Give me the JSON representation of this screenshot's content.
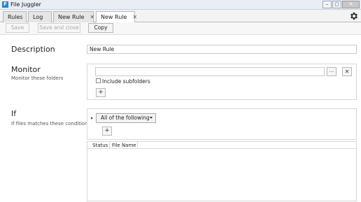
{
  "window": {
    "title": "File Juggler",
    "app_icon_letter": "F",
    "min_glyph": "–",
    "max_glyph": "▢",
    "close_glyph": "✕"
  },
  "tabs": [
    {
      "label": "Rules",
      "active": false,
      "closable": false
    },
    {
      "label": "Log",
      "active": false,
      "closable": false
    },
    {
      "label": "New Rule",
      "active": false,
      "closable": true
    },
    {
      "label": "New Rule",
      "active": true,
      "closable": true
    }
  ],
  "tab_close_glyph": "✕",
  "toolbar": {
    "save_label": "Save",
    "save_and_close_label": "Save and close",
    "copy_label": "Copy"
  },
  "description": {
    "label": "Description",
    "value": "New Rule"
  },
  "monitor": {
    "label": "Monitor",
    "subtitle": "Monitor these folders",
    "folder_value": "",
    "browse_label": "...",
    "remove_glyph": "✕",
    "include_subfolders_label": "Include subfolders",
    "include_subfolders_checked": false,
    "add_glyph": "+"
  },
  "if_section": {
    "label": "If",
    "subtitle": "If files matches these conditions",
    "condition_mode": "All of the following",
    "add_glyph": "+"
  },
  "results_table": {
    "columns": [
      "Status",
      "File Name"
    ],
    "rows": []
  },
  "icons": {
    "settings": "gear-icon",
    "expand": "triangle-right-icon"
  }
}
